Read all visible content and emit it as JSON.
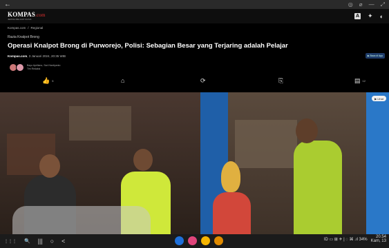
{
  "system": {
    "back_glyph": "←",
    "top_icons": [
      "◎",
      "⌀",
      "—",
      "⤢"
    ]
  },
  "header": {
    "logo_text": "KOMPAS",
    "logo_suffix": ".com",
    "logo_tagline": "JERNIH MELIHAT DUNIA",
    "icons": [
      "A",
      "✦",
      "◐"
    ]
  },
  "article": {
    "breadcrumb": [
      "Kompas.com",
      "Regional"
    ],
    "kicker": "Razia Knalpot Brong",
    "headline": "Operasi Knalpot Brong di Purworejo, Polisi: Sebagian Besar yang Terjaring adalah Pelajar",
    "source": "Kompas.com",
    "date": ", 3 Januari 2024, 20:35 WIB",
    "authors_line1": "Bayu Apriliano, Sari Hardiyanto",
    "authors_line2": "Tim Redaksi",
    "shortcut_label": "▶ Baca di App",
    "likes": "5",
    "comments": "12",
    "action_icons": {
      "like": "👍",
      "tag": "⌂",
      "share": "⟳",
      "bookmark": "⎘",
      "comment": "▤"
    },
    "photo_badge": "▶ Lihat"
  },
  "taskbar": {
    "left_icons": [
      "⋮⋮⋮",
      "🔍",
      "|||",
      "○",
      "<"
    ],
    "apps": [
      "#1e6fd9",
      "#e0457b",
      "#f5b400",
      "#e08a00"
    ],
    "status": "ID  ▭  ⊞  ✈  |  ◌  ⌘ .ıl 34%",
    "time": "20.54",
    "date": "Kam, 13"
  }
}
